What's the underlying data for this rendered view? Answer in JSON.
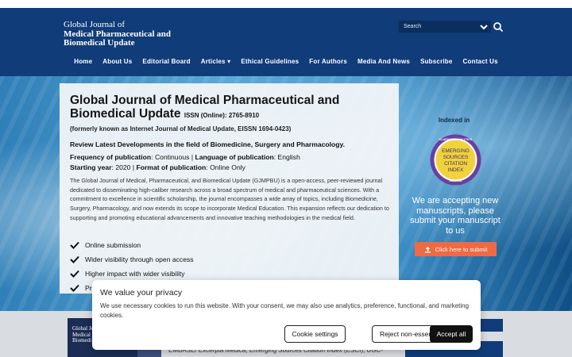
{
  "header": {
    "logo_line1": "Global Journal of",
    "logo_line2": "Medical Pharmaceutical and",
    "logo_line3": "Biomedical Update",
    "search_placeholder": "Search"
  },
  "nav": {
    "items": [
      "Home",
      "About Us",
      "Editorial Board",
      "Articles ▾",
      "Ethical Guidelines",
      "For Authors",
      "Media And News",
      "Subscribe",
      "Contact Us"
    ]
  },
  "hero": {
    "title_main": "Global Journal of Medical Pharmaceutical and Biomedical Update",
    "issn": "ISSN (Online): 2765-8910",
    "formerly": "(formerly known as Internet Journal of Medical Update, EISSN 1694-0423)",
    "review": "Review Latest Developments in the field of Biomedicine, Surgery and Pharmacology.",
    "freq_label": "Frequency of publication",
    "freq_value": ": Continuous | ",
    "lang_label": "Language of publication",
    "lang_value": ": English",
    "start_label": "Starting year",
    "start_value": ": 2020 | ",
    "format_label": "Format of publication",
    "format_value": ": Online Only",
    "description": "The Global Journal of Medical, Pharmaceutical, and Biomedical Update (GJMPBU) is a open-access, peer-reviewed journal dedicated to disseminating high-caliber research across a broad spectrum of medical and pharmaceutical sciences. With a commitment to excellence in scientific scholarship, the journal encompasses a wide array of topics, including Biomedicine, Surgery, Pharmacology, and now extends its scope to incorporate Medical Education. This expansion reflects our dedication to supporting and promoting educational advancements and innovative teaching methodologies in the medical field.",
    "features": [
      "Online submission",
      "Wider visibility through open access",
      "Higher impact with wider visibility",
      "Pr"
    ]
  },
  "sidebar": {
    "indexed_in": "Indexed in",
    "badge_top": "CLARIVATE ANALYTICS",
    "badge_l1": "EMERGING",
    "badge_l2": "SOURCES",
    "badge_l3": "CITATION",
    "badge_l4": "INDEX",
    "badge_bottom": "INDEXED",
    "accepting": "We are accepting new manuscripts, please submit your manuscript to us",
    "submit_label": "Click here to submit"
  },
  "bottom": {
    "thumb_line1": "Global Jo",
    "thumb_line2": "Medical",
    "thumb_line3": "Biomedi",
    "indexing_text": "EMBASE/ Excerpta Medica, Emerging Sources Citation Index (ESCI), UGC-"
  },
  "cookie": {
    "title": "We value your privacy",
    "text": "We use necessary cookies to run this website. With your consent, we may also use analytics, preference, functional, and marketing cookies.",
    "settings_label": "Cookie settings",
    "reject_label": "Reject non-essential",
    "accept_label": "Accept all"
  },
  "colors": {
    "header_bg": "#103c79",
    "submit_btn": "#ee6a45",
    "badge_purple": "#6a3fa0",
    "badge_yellow": "#f2d23c"
  }
}
